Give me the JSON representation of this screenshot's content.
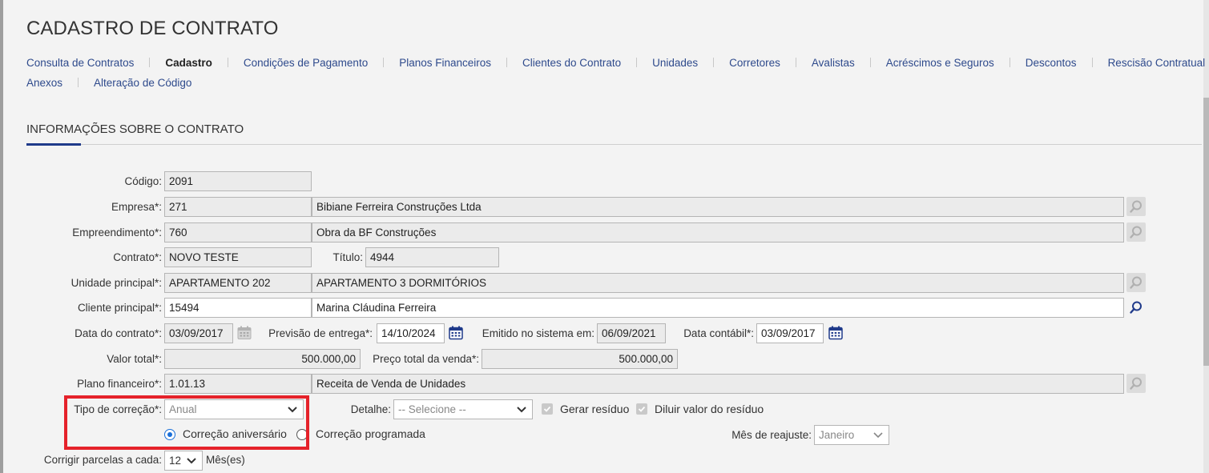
{
  "page": {
    "title": "CADASTRO DE CONTRATO"
  },
  "tabs": [
    {
      "label": "Consulta de Contratos"
    },
    {
      "label": "Cadastro"
    },
    {
      "label": "Condições de Pagamento"
    },
    {
      "label": "Planos Financeiros"
    },
    {
      "label": "Clientes do Contrato"
    },
    {
      "label": "Unidades"
    },
    {
      "label": "Corretores"
    },
    {
      "label": "Avalistas"
    },
    {
      "label": "Acréscimos e Seguros"
    },
    {
      "label": "Descontos"
    },
    {
      "label": "Rescisão Contratual"
    },
    {
      "label": "Anexos"
    },
    {
      "label": "Alteração de Código"
    }
  ],
  "section": {
    "title": "INFORMAÇÕES SOBRE O CONTRATO"
  },
  "form": {
    "codigo": {
      "label": "Código:",
      "value": "2091"
    },
    "empresa": {
      "label": "Empresa*:",
      "code": "271",
      "name": "Bibiane Ferreira Construções Ltda"
    },
    "empreendimento": {
      "label": "Empreendimento*:",
      "code": "760",
      "name": "Obra da BF Construções"
    },
    "contrato": {
      "label": "Contrato*:",
      "value": "NOVO TESTE"
    },
    "titulo": {
      "label": "Título:",
      "value": "4944"
    },
    "unidade": {
      "label": "Unidade principal*:",
      "code": "APARTAMENTO 202",
      "name": "APARTAMENTO 3 DORMITÓRIOS"
    },
    "cliente": {
      "label": "Cliente principal*:",
      "code": "15494",
      "name": "Marina Cláudina Ferreira"
    },
    "data_contrato": {
      "label": "Data do contrato*:",
      "value": "03/09/2017"
    },
    "previsao_entrega": {
      "label": "Previsão de entrega*:",
      "value": "14/10/2024"
    },
    "emitido": {
      "label": "Emitido no sistema em:",
      "value": "06/09/2021"
    },
    "data_contabil": {
      "label": "Data contábil*:",
      "value": "03/09/2017"
    },
    "valor_total": {
      "label": "Valor total*:",
      "value": "500.000,00"
    },
    "preco_total": {
      "label": "Preço total da venda*:",
      "value": "500.000,00"
    },
    "plano": {
      "label": "Plano financeiro*:",
      "code": "1.01.13",
      "name": "Receita de Venda de Unidades"
    },
    "tipo_correcao": {
      "label": "Tipo de correção*:",
      "value": "Anual"
    },
    "detalhe": {
      "label": "Detalhe:",
      "value": "-- Selecione --"
    },
    "gerar_residuo": {
      "label": "Gerar resíduo",
      "checked": true
    },
    "diluir_residuo": {
      "label": "Diluir valor do resíduo",
      "checked": true
    },
    "correcao_aniversario": {
      "label": "Correção aniversário",
      "selected": true
    },
    "correcao_programada": {
      "label": "Correção programada",
      "selected": false
    },
    "mes_reajuste": {
      "label": "Mês de reajuste:",
      "value": "Janeiro"
    },
    "corrigir_parcelas": {
      "label": "Corrigir parcelas a cada:",
      "value": "12",
      "unit": "Mês(es)"
    }
  },
  "icons": {
    "lookup": "search-icon",
    "calendar": "calendar-icon",
    "dropdown": "chevron-down-icon"
  },
  "colors": {
    "link": "#2e4a8c",
    "accent": "#1f3a8a",
    "highlight": "#e5222a",
    "radio": "#1a6fd8"
  }
}
